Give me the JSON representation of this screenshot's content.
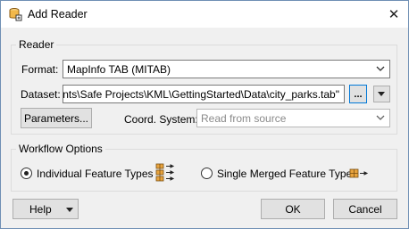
{
  "window": {
    "title": "Add Reader",
    "close_glyph": "✕"
  },
  "reader": {
    "group_label": "Reader",
    "format_label": "Format:",
    "format_value": "MapInfo TAB (MITAB)",
    "dataset_label": "Dataset:",
    "dataset_value": "cuments\\Safe Projects\\KML\\GettingStarted\\Data\\city_parks.tab\"",
    "browse_label": "...",
    "parameters_label": "Parameters...",
    "coord_label": "Coord. System:",
    "coord_value": "Read from source"
  },
  "workflow": {
    "group_label": "Workflow Options",
    "option_individual": "Individual Feature Types",
    "option_merged": "Single Merged Feature Type",
    "selected": "individual"
  },
  "footer": {
    "help_label": "Help",
    "ok_label": "OK",
    "cancel_label": "Cancel"
  },
  "colors": {
    "focus_border": "#0078d7",
    "group_border": "#dcdcdc",
    "dialog_bg": "#f0f0f0",
    "icon_orange": "#e8a33d"
  },
  "icons": {
    "app": "reader-app-icon",
    "individual": "multiple-feature-types-icon",
    "merged": "single-feature-type-icon"
  }
}
